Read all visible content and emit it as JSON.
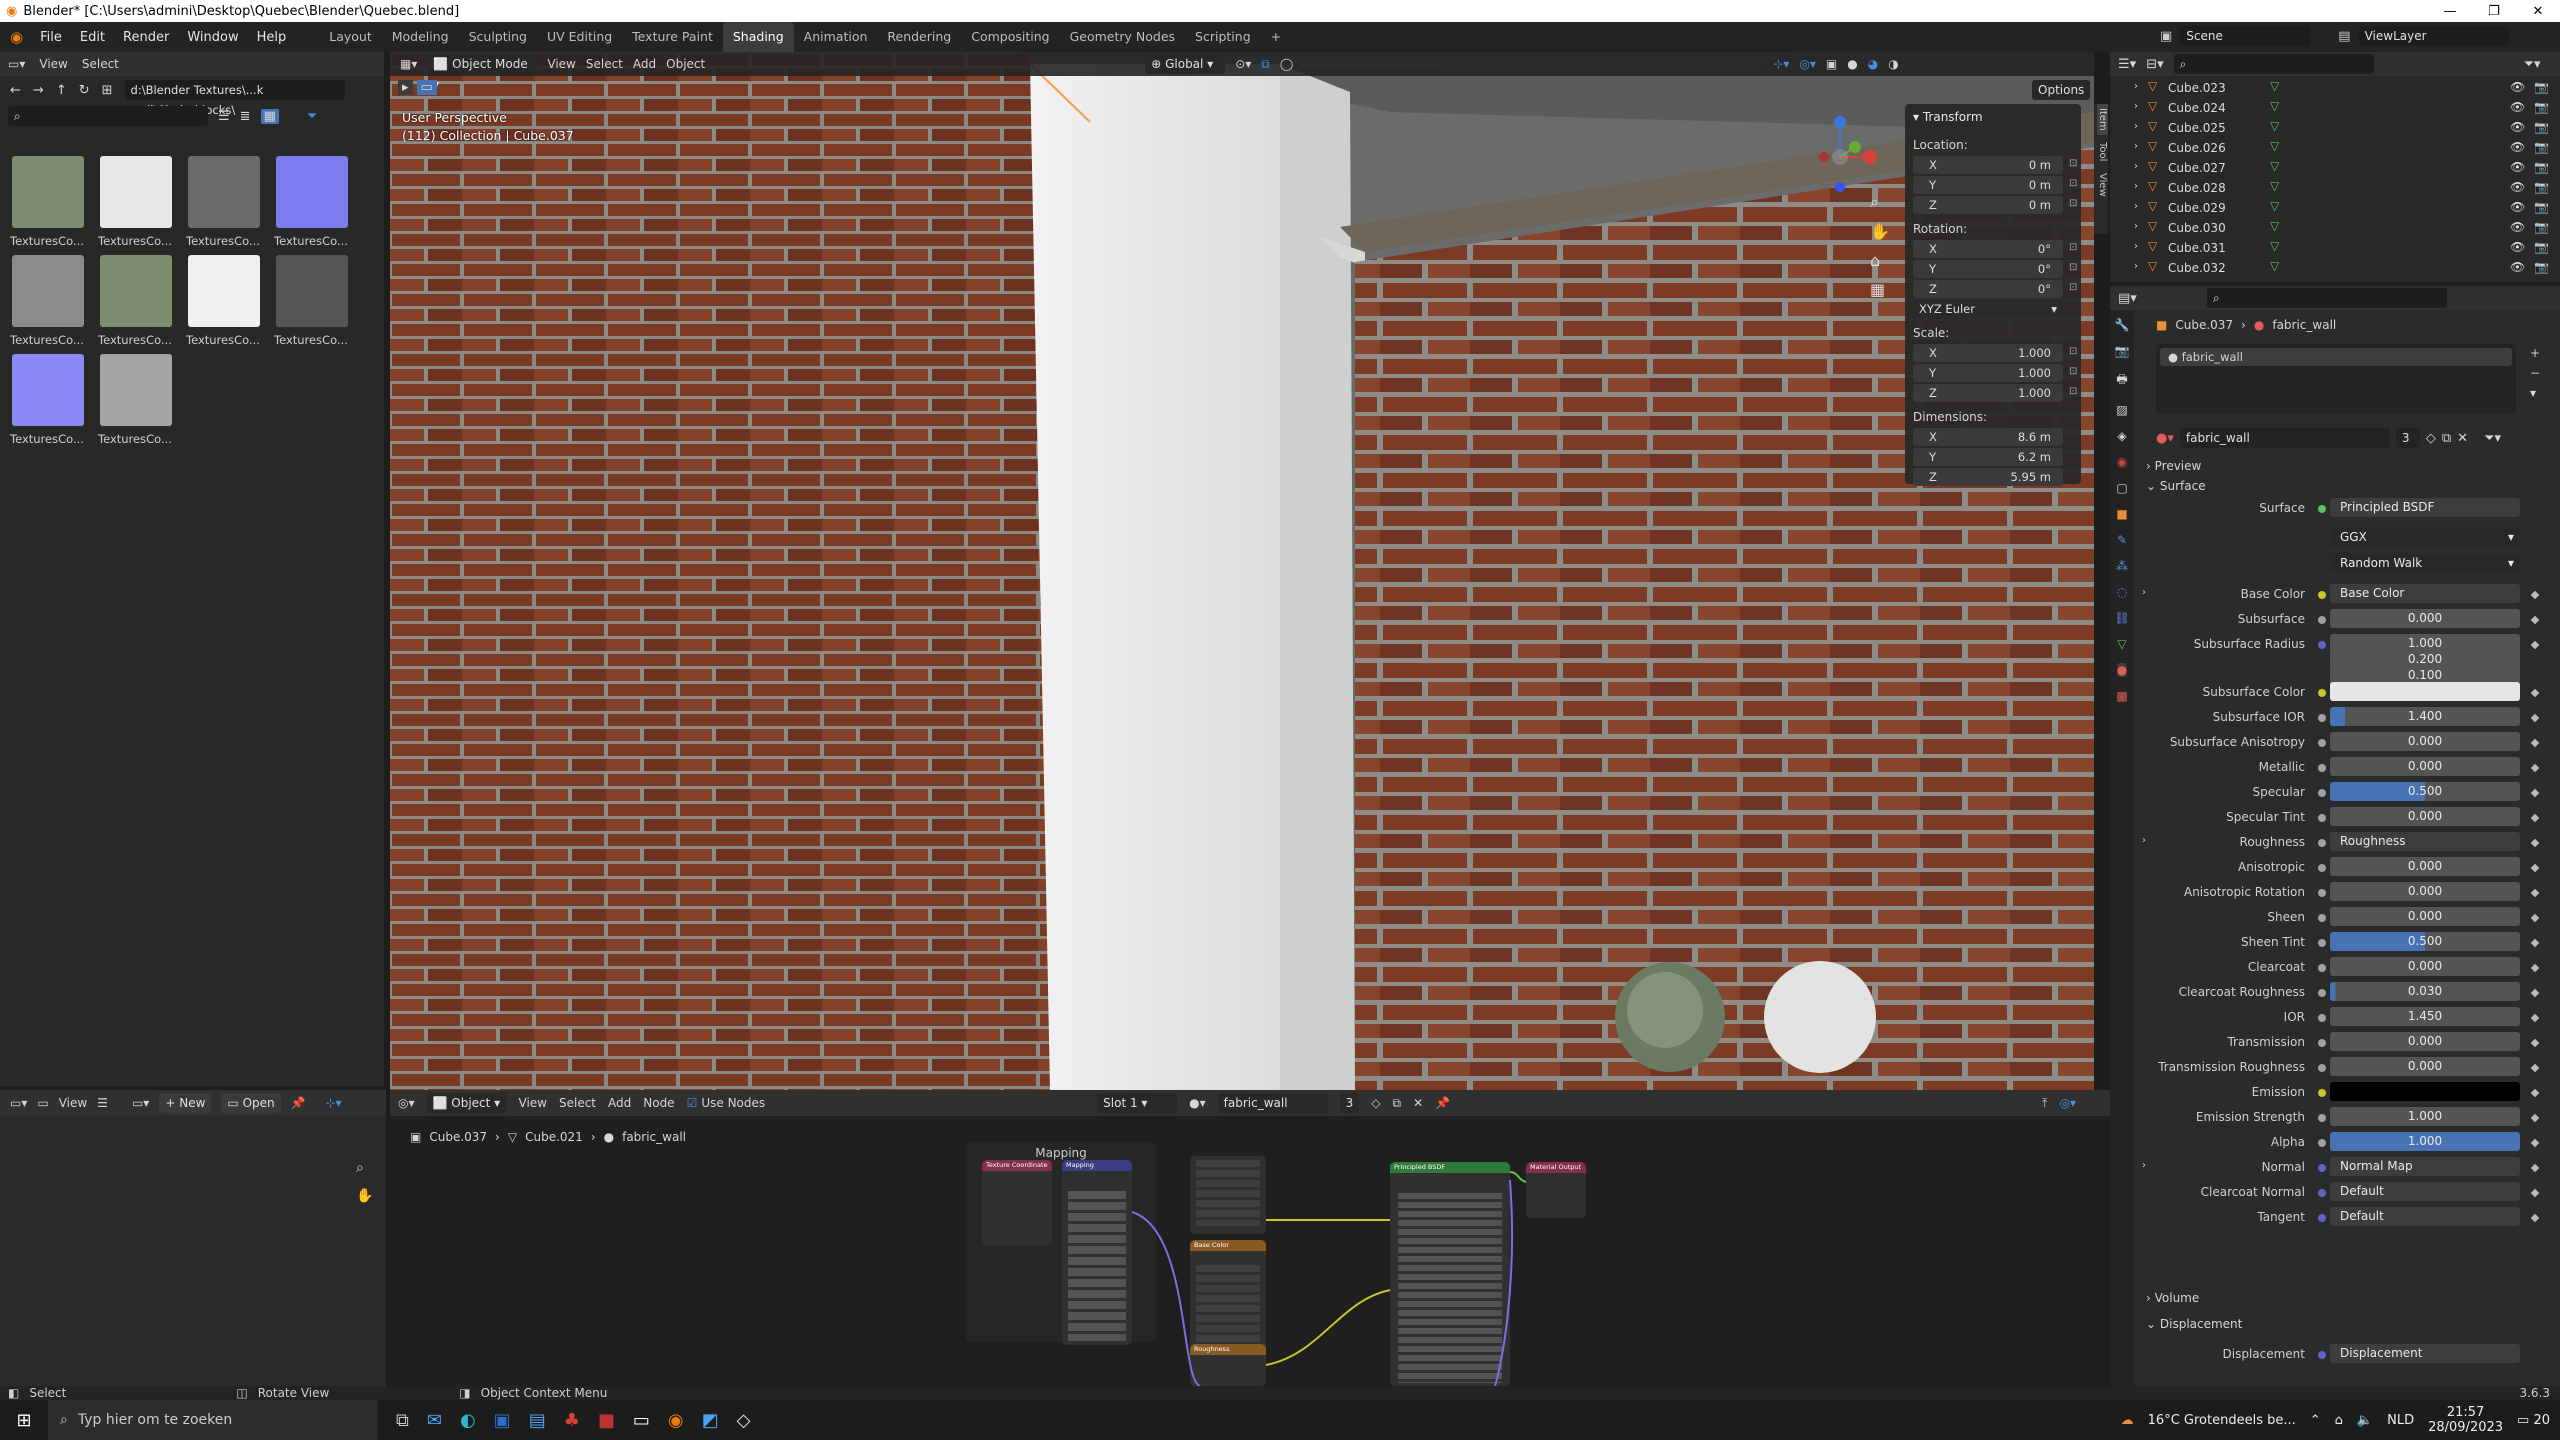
{
  "window": {
    "title": "Blender* [C:\\Users\\admini\\Desktop\\Quebec\\Blender\\Quebec.blend]"
  },
  "menu": [
    "File",
    "Edit",
    "Render",
    "Window",
    "Help"
  ],
  "workspaces": [
    "Layout",
    "Modeling",
    "Sculpting",
    "UV Editing",
    "Texture Paint",
    "Shading",
    "Animation",
    "Rendering",
    "Compositing",
    "Geometry Nodes",
    "Scripting"
  ],
  "active_workspace": "Shading",
  "scene": {
    "name": "Scene",
    "view_layer": "ViewLayer"
  },
  "file_browser": {
    "header": [
      "View",
      "Select"
    ],
    "path": "d:\\Blender Textures\\...k wall\\Cinderblocks\\",
    "thumbs": [
      {
        "label": "TexturesCo...",
        "color": "#7c8c6e"
      },
      {
        "label": "TexturesCo...",
        "color": "#e8e8e8"
      },
      {
        "label": "TexturesCo...",
        "color": "#6a6a6a"
      },
      {
        "label": "TexturesCo...",
        "color": "#7d7bf0"
      },
      {
        "label": "TexturesCo...",
        "color": "#8b8b8b"
      },
      {
        "label": "TexturesCo...",
        "color": "#7c8c6e"
      },
      {
        "label": "TexturesCo...",
        "color": "#efefef"
      },
      {
        "label": "TexturesCo...",
        "color": "#555555"
      },
      {
        "label": "TexturesCo...",
        "color": "#8b89f6"
      },
      {
        "label": "TexturesCo...",
        "color": "#a4a4a4"
      }
    ]
  },
  "viewport": {
    "mode": "Object Mode",
    "header_menus": [
      "View",
      "Select",
      "Add",
      "Object"
    ],
    "orientation": "Global",
    "options": "Options",
    "overlay_line1": "User Perspective",
    "overlay_line2": "(112) Collection | Cube.037"
  },
  "transform": {
    "title": "Transform",
    "location_label": "Location:",
    "location": [
      {
        "axis": "X",
        "value": "0 m"
      },
      {
        "axis": "Y",
        "value": "0 m"
      },
      {
        "axis": "Z",
        "value": "0 m"
      }
    ],
    "rotation_label": "Rotation:",
    "rotation": [
      {
        "axis": "X",
        "value": "0°"
      },
      {
        "axis": "Y",
        "value": "0°"
      },
      {
        "axis": "Z",
        "value": "0°"
      }
    ],
    "rotation_mode": "XYZ Euler",
    "scale_label": "Scale:",
    "scale": [
      {
        "axis": "X",
        "value": "1.000"
      },
      {
        "axis": "Y",
        "value": "1.000"
      },
      {
        "axis": "Z",
        "value": "1.000"
      }
    ],
    "dimensions_label": "Dimensions:",
    "dimensions": [
      {
        "axis": "X",
        "value": "8.6 m"
      },
      {
        "axis": "Y",
        "value": "6.2 m"
      },
      {
        "axis": "Z",
        "value": "5.95 m"
      }
    ]
  },
  "sidebar_tabs": [
    "Item",
    "Tool",
    "View"
  ],
  "outliner": {
    "items": [
      "Cube.023",
      "Cube.024",
      "Cube.025",
      "Cube.026",
      "Cube.027",
      "Cube.028",
      "Cube.029",
      "Cube.030",
      "Cube.031",
      "Cube.032"
    ]
  },
  "properties": {
    "breadcrumb_object": "Cube.037",
    "breadcrumb_material": "fabric_wall",
    "slot_name": "fabric_wall",
    "material_name": "fabric_wall",
    "material_users": "3",
    "sections": {
      "preview": "Preview",
      "surface": "Surface",
      "volume": "Volume",
      "displacement": "Displacement"
    },
    "surface_label": "Surface",
    "surface_value": "Principled BSDF",
    "distribution": "GGX",
    "subsurface_method": "Random Walk",
    "rows": [
      {
        "label": "Base Color",
        "kind": "link",
        "value": "Base Color",
        "dot": "#c7c729"
      },
      {
        "label": "Subsurface",
        "kind": "value",
        "value": "0.000",
        "dot": "#a1a1a1"
      },
      {
        "label": "Subsurface Radius",
        "kind": "value",
        "value": "1.000",
        "dot": "#6363c7"
      },
      {
        "label": "",
        "kind": "value",
        "value": "0.200",
        "dot": ""
      },
      {
        "label": "",
        "kind": "value",
        "value": "0.100",
        "dot": ""
      },
      {
        "label": "Subsurface Color",
        "kind": "color",
        "value": "#e6e6e6",
        "dot": "#c7c729"
      },
      {
        "label": "Subsurface IOR",
        "kind": "slider",
        "value": "1.400",
        "fill": 0.08,
        "dot": "#a1a1a1"
      },
      {
        "label": "Subsurface Anisotropy",
        "kind": "value",
        "value": "0.000",
        "dot": "#a1a1a1"
      },
      {
        "label": "Metallic",
        "kind": "value",
        "value": "0.000",
        "dot": "#a1a1a1"
      },
      {
        "label": "Specular",
        "kind": "slider",
        "value": "0.500",
        "fill": 0.5,
        "dot": "#a1a1a1"
      },
      {
        "label": "Specular Tint",
        "kind": "value",
        "value": "0.000",
        "dot": "#a1a1a1"
      },
      {
        "label": "Roughness",
        "kind": "link",
        "value": "Roughness",
        "dot": "#a1a1a1"
      },
      {
        "label": "Anisotropic",
        "kind": "value",
        "value": "0.000",
        "dot": "#a1a1a1"
      },
      {
        "label": "Anisotropic Rotation",
        "kind": "value",
        "value": "0.000",
        "dot": "#a1a1a1"
      },
      {
        "label": "Sheen",
        "kind": "value",
        "value": "0.000",
        "dot": "#a1a1a1"
      },
      {
        "label": "Sheen Tint",
        "kind": "slider",
        "value": "0.500",
        "fill": 0.5,
        "dot": "#a1a1a1"
      },
      {
        "label": "Clearcoat",
        "kind": "value",
        "value": "0.000",
        "dot": "#a1a1a1"
      },
      {
        "label": "Clearcoat Roughness",
        "kind": "slider",
        "value": "0.030",
        "fill": 0.03,
        "dot": "#a1a1a1"
      },
      {
        "label": "IOR",
        "kind": "value",
        "value": "1.450",
        "dot": "#a1a1a1"
      },
      {
        "label": "Transmission",
        "kind": "value",
        "value": "0.000",
        "dot": "#a1a1a1"
      },
      {
        "label": "Transmission Roughness",
        "kind": "value",
        "value": "0.000",
        "dot": "#a1a1a1"
      },
      {
        "label": "Emission",
        "kind": "color",
        "value": "#000000",
        "dot": "#c7c729"
      },
      {
        "label": "Emission Strength",
        "kind": "value",
        "value": "1.000",
        "dot": "#a1a1a1"
      },
      {
        "label": "Alpha",
        "kind": "slider",
        "value": "1.000",
        "fill": 1.0,
        "dot": "#a1a1a1"
      },
      {
        "label": "Normal",
        "kind": "link",
        "value": "Normal Map",
        "dot": "#6363c7"
      },
      {
        "label": "Clearcoat Normal",
        "kind": "link",
        "value": "Default",
        "dot": "#6363c7"
      },
      {
        "label": "Tangent",
        "kind": "link",
        "value": "Default",
        "dot": "#6363c7"
      }
    ],
    "displacement_label": "Displacement",
    "displacement_value": "Displacement"
  },
  "uv_editor": {
    "view": "View",
    "new": "New",
    "open": "Open"
  },
  "node_editor": {
    "object_mode": "Object",
    "menus": [
      "View",
      "Select",
      "Add",
      "Node"
    ],
    "use_nodes": "Use Nodes",
    "slot": "Slot 1",
    "material": "fabric_wall",
    "users": "3",
    "breadcrumb": [
      "Cube.037",
      "Cube.021",
      "fabric_wall"
    ],
    "frame_label": "Mapping",
    "nodes": {
      "texcoord": "Texture Coordinate",
      "mapping": "Mapping",
      "basecolor": "Base Color",
      "roughness": "Roughness",
      "bsdf": "Principled BSDF",
      "output": "Material Output"
    }
  },
  "status": {
    "left": "Select",
    "middle": "Rotate View",
    "context": "Object Context Menu",
    "version": "3.6.3"
  },
  "taskbar": {
    "search_placeholder": "Typ hier om te zoeken",
    "weather": "16°C  Grotendeels be...",
    "lang": "NLD",
    "time": "21:57",
    "date": "28/09/2023",
    "notif": "20"
  }
}
